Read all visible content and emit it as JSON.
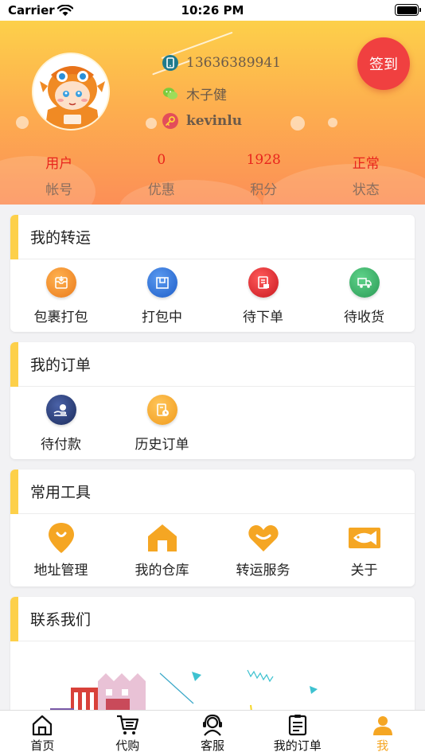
{
  "status_bar": {
    "carrier": "Carrier",
    "time": "10:26 PM"
  },
  "profile": {
    "phone": "13636389941",
    "name": "木子健",
    "username": "kevinlu",
    "signin_label": "签到"
  },
  "stats": [
    {
      "value": "用户",
      "label": "帐号"
    },
    {
      "value": "0",
      "label": "优惠"
    },
    {
      "value": "1928",
      "label": "积分"
    },
    {
      "value": "正常",
      "label": "状态"
    }
  ],
  "transport": {
    "title": "我的转运",
    "items": [
      {
        "label": "包裹打包",
        "icon": "package-pack-icon",
        "color": "#f0902a"
      },
      {
        "label": "打包中",
        "icon": "packing-box-icon",
        "color": "#2f6fd8"
      },
      {
        "label": "待下单",
        "icon": "pending-order-icon",
        "color": "#e3262b"
      },
      {
        "label": "待收货",
        "icon": "awaiting-receipt-icon",
        "color": "#3db36a"
      }
    ]
  },
  "orders": {
    "title": "我的订单",
    "items": [
      {
        "label": "待付款",
        "icon": "pending-payment-icon",
        "color": "#2b3f7a"
      },
      {
        "label": "历史订单",
        "icon": "order-history-icon",
        "color": "#f5a623"
      }
    ]
  },
  "tools": {
    "title": "常用工具",
    "items": [
      {
        "label": "地址管理",
        "icon": "location-pin-icon"
      },
      {
        "label": "我的仓库",
        "icon": "warehouse-icon"
      },
      {
        "label": "转运服务",
        "icon": "heart-icon"
      },
      {
        "label": "关于",
        "icon": "fish-icon"
      }
    ],
    "accent": "#f5a623"
  },
  "contact": {
    "title": "联系我们"
  },
  "tabbar": {
    "items": [
      {
        "label": "首页",
        "icon": "home-icon"
      },
      {
        "label": "代购",
        "icon": "cart-icon"
      },
      {
        "label": "客服",
        "icon": "support-headset-icon"
      },
      {
        "label": "我的订单",
        "icon": "orders-list-icon"
      },
      {
        "label": "我",
        "icon": "user-icon",
        "active": true
      }
    ],
    "active_color": "#f5a623"
  }
}
